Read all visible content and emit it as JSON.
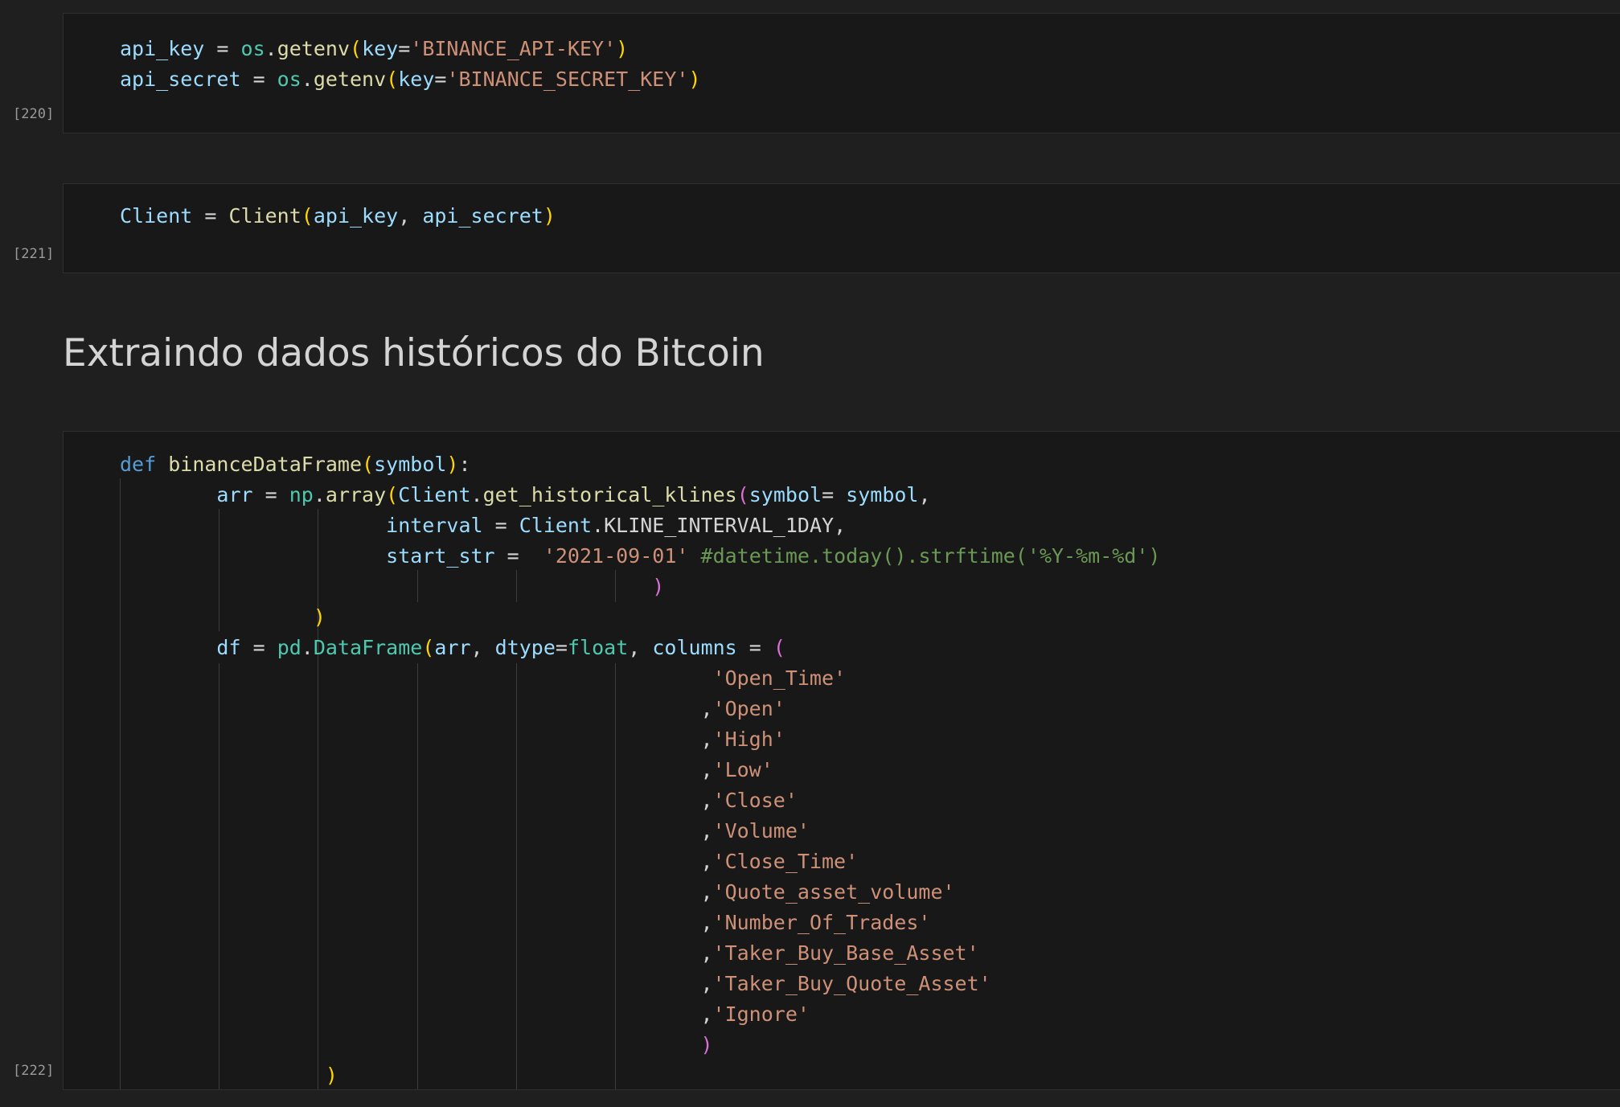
{
  "cells": [
    {
      "exec_count": "[220]",
      "lines": [
        [
          [
            "var",
            "api_key"
          ],
          [
            "op",
            " = "
          ],
          [
            "mod",
            "os"
          ],
          [
            "op",
            "."
          ],
          [
            "fn",
            "getenv"
          ],
          [
            "p1",
            "("
          ],
          [
            "var",
            "key"
          ],
          [
            "op",
            "="
          ],
          [
            "str",
            "'BINANCE_API-KEY'"
          ],
          [
            "p1",
            ")"
          ]
        ],
        [
          [
            "var",
            "api_secret"
          ],
          [
            "op",
            " = "
          ],
          [
            "mod",
            "os"
          ],
          [
            "op",
            "."
          ],
          [
            "fn",
            "getenv"
          ],
          [
            "p1",
            "("
          ],
          [
            "var",
            "key"
          ],
          [
            "op",
            "="
          ],
          [
            "str",
            "'BINANCE_SECRET_KEY'"
          ],
          [
            "p1",
            ")"
          ]
        ]
      ]
    },
    {
      "exec_count": "[221]",
      "lines": [
        [
          [
            "var",
            "Client"
          ],
          [
            "op",
            " = "
          ],
          [
            "fn",
            "Client"
          ],
          [
            "p1",
            "("
          ],
          [
            "var",
            "api_key"
          ],
          [
            "op",
            ", "
          ],
          [
            "var",
            "api_secret"
          ],
          [
            "p1",
            ")"
          ]
        ]
      ]
    },
    {
      "exec_count": "[222]",
      "lines": [
        [
          [
            "kw",
            "def "
          ],
          [
            "fn",
            "binanceDataFrame"
          ],
          [
            "p1",
            "("
          ],
          [
            "var",
            "symbol"
          ],
          [
            "p1",
            ")"
          ],
          [
            "op",
            ":"
          ]
        ],
        [
          [
            "op",
            "        "
          ],
          [
            "var",
            "arr"
          ],
          [
            "op",
            " = "
          ],
          [
            "mod",
            "np"
          ],
          [
            "op",
            "."
          ],
          [
            "fn",
            "array"
          ],
          [
            "p1",
            "("
          ],
          [
            "var",
            "Client"
          ],
          [
            "op",
            "."
          ],
          [
            "fn",
            "get_historical_klines"
          ],
          [
            "p2",
            "("
          ],
          [
            "var",
            "symbol"
          ],
          [
            "op",
            "= "
          ],
          [
            "var",
            "symbol"
          ],
          [
            "op",
            ","
          ]
        ],
        [
          [
            "op",
            "                      "
          ],
          [
            "var",
            "interval"
          ],
          [
            "op",
            " = "
          ],
          [
            "var",
            "Client"
          ],
          [
            "op",
            "."
          ],
          [
            "const",
            "KLINE_INTERVAL_1DAY"
          ],
          [
            "op",
            ","
          ]
        ],
        [
          [
            "op",
            "                      "
          ],
          [
            "var",
            "start_str"
          ],
          [
            "op",
            " =  "
          ],
          [
            "str",
            "'2021-09-01'"
          ],
          [
            "op",
            " "
          ],
          [
            "cmt",
            "#datetime.today().strftime('%Y-%m-%d')"
          ]
        ],
        [
          [
            "op",
            "                                            "
          ],
          [
            "p2",
            ")"
          ]
        ],
        [
          [
            "op",
            "                "
          ],
          [
            "p1",
            ")"
          ]
        ],
        [
          [
            "op",
            "        "
          ],
          [
            "var",
            "df"
          ],
          [
            "op",
            " = "
          ],
          [
            "mod",
            "pd"
          ],
          [
            "op",
            "."
          ],
          [
            "mod",
            "DataFrame"
          ],
          [
            "p1",
            "("
          ],
          [
            "var",
            "arr"
          ],
          [
            "op",
            ", "
          ],
          [
            "var",
            "dtype"
          ],
          [
            "op",
            "="
          ],
          [
            "mod",
            "float"
          ],
          [
            "op",
            ", "
          ],
          [
            "var",
            "columns"
          ],
          [
            "op",
            " = "
          ],
          [
            "p2",
            "("
          ]
        ],
        [
          [
            "op",
            "                                                 "
          ],
          [
            "str",
            "'Open_Time'"
          ]
        ],
        [
          [
            "op",
            "                                                "
          ],
          [
            "op",
            ","
          ],
          [
            "str",
            "'Open'"
          ]
        ],
        [
          [
            "op",
            "                                                "
          ],
          [
            "op",
            ","
          ],
          [
            "str",
            "'High'"
          ]
        ],
        [
          [
            "op",
            "                                                "
          ],
          [
            "op",
            ","
          ],
          [
            "str",
            "'Low'"
          ]
        ],
        [
          [
            "op",
            "                                                "
          ],
          [
            "op",
            ","
          ],
          [
            "str",
            "'Close'"
          ]
        ],
        [
          [
            "op",
            "                                                "
          ],
          [
            "op",
            ","
          ],
          [
            "str",
            "'Volume'"
          ]
        ],
        [
          [
            "op",
            "                                                "
          ],
          [
            "op",
            ","
          ],
          [
            "str",
            "'Close_Time'"
          ]
        ],
        [
          [
            "op",
            "                                                "
          ],
          [
            "op",
            ","
          ],
          [
            "str",
            "'Quote_asset_volume'"
          ]
        ],
        [
          [
            "op",
            "                                                "
          ],
          [
            "op",
            ","
          ],
          [
            "str",
            "'Number_Of_Trades'"
          ]
        ],
        [
          [
            "op",
            "                                                "
          ],
          [
            "op",
            ","
          ],
          [
            "str",
            "'Taker_Buy_Base_Asset'"
          ]
        ],
        [
          [
            "op",
            "                                                "
          ],
          [
            "op",
            ","
          ],
          [
            "str",
            "'Taker_Buy_Quote_Asset'"
          ]
        ],
        [
          [
            "op",
            "                                                "
          ],
          [
            "op",
            ","
          ],
          [
            "str",
            "'Ignore'"
          ]
        ],
        [
          [
            "op",
            "                                                "
          ],
          [
            "p2",
            ")"
          ]
        ],
        [
          [
            "op",
            "                 "
          ],
          [
            "p1",
            ")"
          ]
        ]
      ]
    }
  ],
  "markdown_heading": "Extraindo dados históricos do Bitcoin",
  "colors": {
    "keyword": "#569cd6",
    "function": "#dcdcaa",
    "variable": "#9cdcfe",
    "module": "#4ec9b0",
    "string": "#ce9178",
    "comment": "#6a9955",
    "bracket1": "#ffd700",
    "bracket2": "#da70d6",
    "background": "#1f1f1f",
    "cell_background": "#181818"
  }
}
